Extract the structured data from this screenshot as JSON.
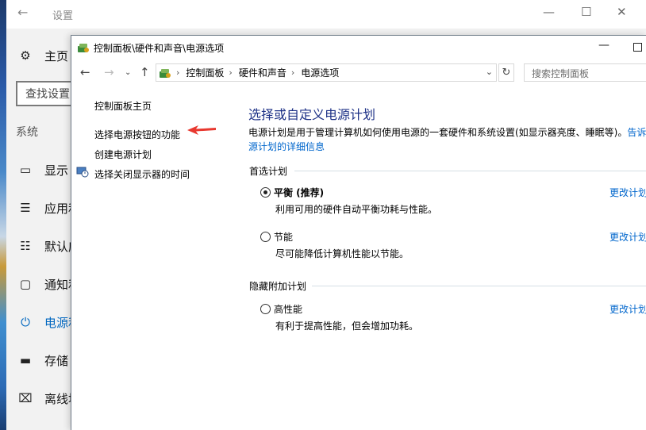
{
  "settings": {
    "title": "设置",
    "home": "主页",
    "search_placeholder": "查找设置",
    "section": "系统",
    "items": [
      {
        "label": "显示"
      },
      {
        "label": "应用和"
      },
      {
        "label": "默认应"
      },
      {
        "label": "通知和"
      },
      {
        "label": "电源和"
      },
      {
        "label": "存储"
      },
      {
        "label": "离线地"
      }
    ]
  },
  "control_panel": {
    "title": "控制面板\\硬件和声音\\电源选项",
    "breadcrumbs": [
      "控制面板",
      "硬件和声音",
      "电源选项"
    ],
    "search_placeholder": "搜索控制面板",
    "left_links": [
      {
        "label": "控制面板主页"
      },
      {
        "label": "选择电源按钮的功能"
      },
      {
        "label": "创建电源计划"
      },
      {
        "label": "选择关闭显示器的时间"
      }
    ],
    "main": {
      "title": "选择或自定义电源计划",
      "description": "电源计划是用于管理计算机如何使用电源的一套硬件和系统设置(如显示器亮度、睡眠等)。",
      "description_link_part1": "告诉",
      "description_link_part2": "源计划的详细信息",
      "preferred_group": "首选计划",
      "hidden_group": "隐藏附加计划",
      "plans": [
        {
          "name": "平衡 (推荐)",
          "desc": "利用可用的硬件自动平衡功耗与性能。",
          "selected": true,
          "change": "更改计划"
        },
        {
          "name": "节能",
          "desc": "尽可能降低计算机性能以节能。",
          "selected": false,
          "change": "更改计划"
        },
        {
          "name": "高性能",
          "desc": "有利于提高性能，但会增加功耗。",
          "selected": false,
          "change": "更改计划"
        }
      ]
    }
  },
  "colors": {
    "link": "#0066cc",
    "heading": "#1e3287",
    "accent": "#0067c0",
    "annotation_arrow": "#e8382f"
  }
}
